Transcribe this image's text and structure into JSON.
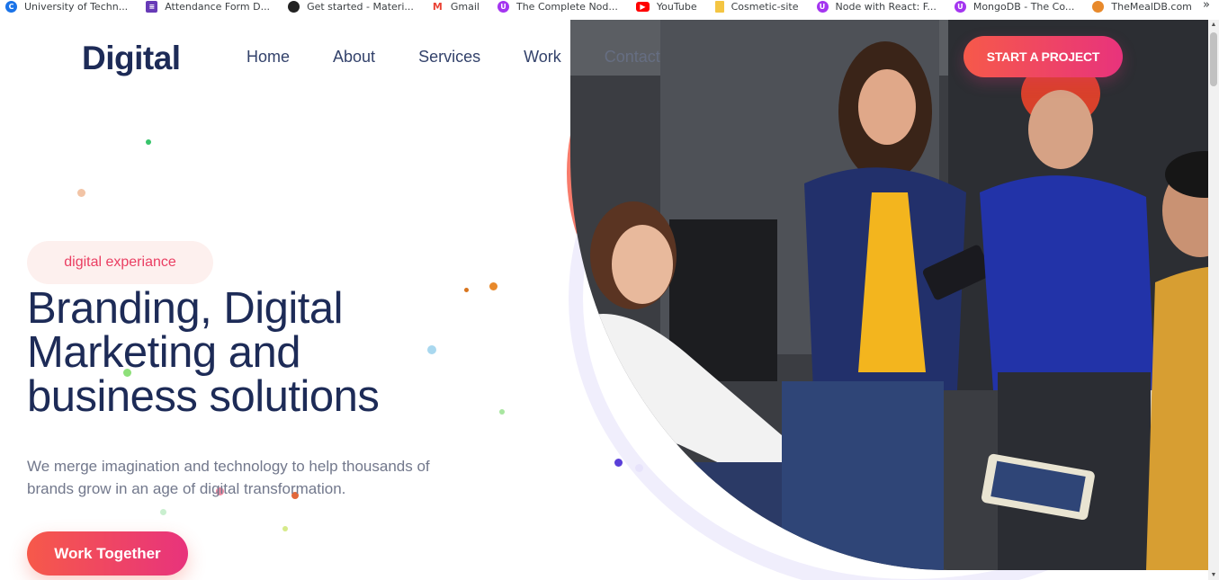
{
  "bookmarks": [
    {
      "label": "University of Techn...",
      "icon": "c-icon",
      "color": "#1a73e8"
    },
    {
      "label": "Attendance Form D...",
      "icon": "form-icon",
      "color": "#673ab7"
    },
    {
      "label": "Get started - Materi...",
      "icon": "github-icon",
      "color": "#222222"
    },
    {
      "label": "Gmail",
      "icon": "gmail-icon",
      "color": "#ea4335"
    },
    {
      "label": "The Complete Nod...",
      "icon": "udemy-icon",
      "color": "#a435f0"
    },
    {
      "label": "YouTube",
      "icon": "youtube-icon",
      "color": "#ff0000"
    },
    {
      "label": "Cosmetic-site",
      "icon": "folder-icon",
      "color": "#f4c542"
    },
    {
      "label": "Node with React: F...",
      "icon": "udemy-icon",
      "color": "#a435f0"
    },
    {
      "label": "MongoDB - The Co...",
      "icon": "udemy-icon",
      "color": "#a435f0"
    },
    {
      "label": "TheMealDB.com",
      "icon": "meal-icon",
      "color": "#e8892b"
    }
  ],
  "bookmarks_more": "»",
  "header": {
    "logo": "Digital",
    "nav": [
      "Home",
      "About",
      "Services",
      "Work",
      "Contact"
    ],
    "cta": "START A PROJECT"
  },
  "hero": {
    "tag": "digital experiance",
    "headline_lines": [
      "Branding, Digital",
      "Marketing and",
      "business solutions"
    ],
    "subtitle_lines": [
      "We merge imagination and technology to help thousands of",
      "brands grow in an age of digital transformation."
    ],
    "button": "Work Together"
  },
  "colors": {
    "brand_navy": "#1d2b57",
    "accent_start": "#f6594a",
    "accent_end": "#e8337c"
  }
}
